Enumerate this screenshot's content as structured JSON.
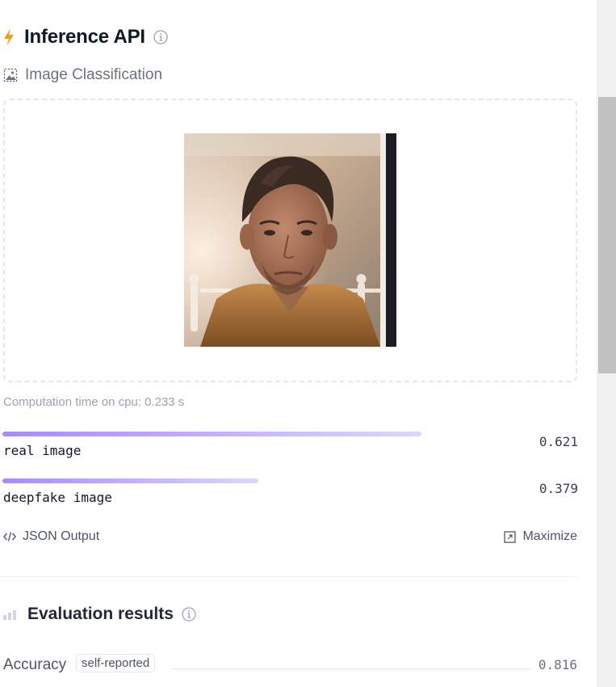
{
  "header": {
    "title": "Inference API"
  },
  "task": {
    "label": "Image Classification"
  },
  "computation": {
    "text": "Computation time on cpu: 0.233 s"
  },
  "results": [
    {
      "label": "real image",
      "score": "0.621",
      "fraction": 0.621
    },
    {
      "label": "deepfake image",
      "score": "0.379",
      "fraction": 0.379
    }
  ],
  "actions": {
    "json": "JSON Output",
    "maximize": "Maximize"
  },
  "evaluation": {
    "title": "Evaluation results",
    "metrics": [
      {
        "name": "Accuracy",
        "badge": "self-reported",
        "value": "0.816"
      }
    ]
  },
  "colors": {
    "accent": "#f59e0b",
    "bar_start": "#a78bfa",
    "bar_end": "#ddd6fe"
  }
}
